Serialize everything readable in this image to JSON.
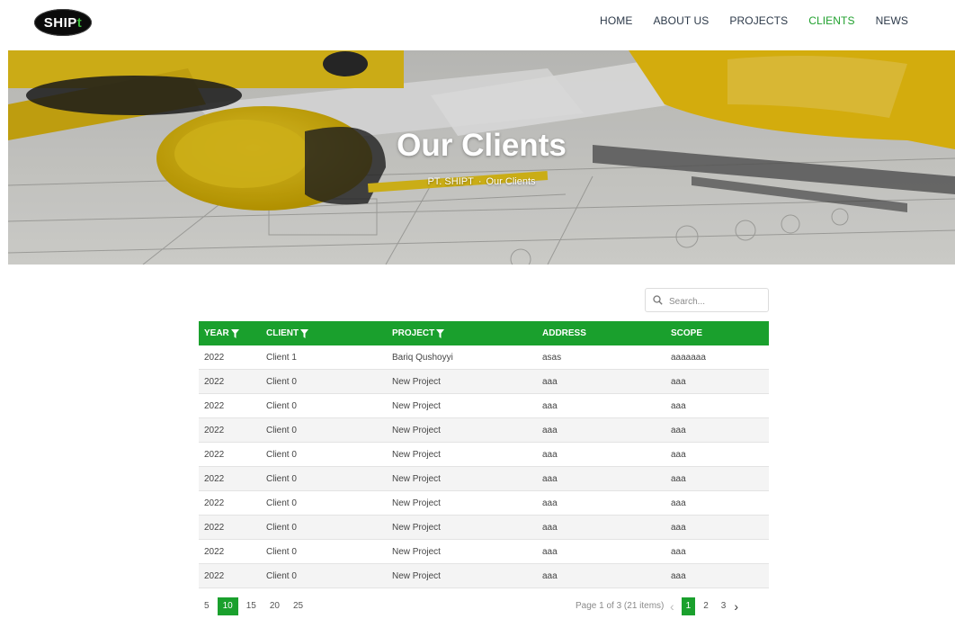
{
  "logo": {
    "text_main": "SHIP",
    "text_accent": "t"
  },
  "nav": {
    "items": [
      {
        "label": "HOME"
      },
      {
        "label": "ABOUT US"
      },
      {
        "label": "PROJECTS"
      },
      {
        "label": "CLIENTS"
      },
      {
        "label": "NEWS"
      }
    ],
    "active_index": 3
  },
  "hero": {
    "title": "Our Clients",
    "breadcrumb": {
      "home": "PT. SHIPT",
      "separator": "·",
      "current": "Our Clients"
    }
  },
  "search": {
    "placeholder": "Search..."
  },
  "table": {
    "columns": [
      {
        "label": "YEAR",
        "filter": true
      },
      {
        "label": "CLIENT",
        "filter": true
      },
      {
        "label": "PROJECT",
        "filter": true
      },
      {
        "label": "ADDRESS",
        "filter": false
      },
      {
        "label": "SCOPE",
        "filter": false
      }
    ],
    "rows": [
      [
        "2022",
        "Client 1",
        "Bariq Qushoyyi",
        "asas",
        "aaaaaaa"
      ],
      [
        "2022",
        "Client 0",
        "New Project",
        "aaa",
        "aaa"
      ],
      [
        "2022",
        "Client 0",
        "New Project",
        "aaa",
        "aaa"
      ],
      [
        "2022",
        "Client 0",
        "New Project",
        "aaa",
        "aaa"
      ],
      [
        "2022",
        "Client 0",
        "New Project",
        "aaa",
        "aaa"
      ],
      [
        "2022",
        "Client 0",
        "New Project",
        "aaa",
        "aaa"
      ],
      [
        "2022",
        "Client 0",
        "New Project",
        "aaa",
        "aaa"
      ],
      [
        "2022",
        "Client 0",
        "New Project",
        "aaa",
        "aaa"
      ],
      [
        "2022",
        "Client 0",
        "New Project",
        "aaa",
        "aaa"
      ],
      [
        "2022",
        "Client 0",
        "New Project",
        "aaa",
        "aaa"
      ]
    ]
  },
  "pager": {
    "page_sizes": [
      "5",
      "10",
      "15",
      "20",
      "25"
    ],
    "selected_size": "10",
    "info": "Page 1 of 3 (21 items)",
    "pages": [
      "1",
      "2",
      "3"
    ],
    "current_page": "1",
    "prev_icon": "chevron-left-icon",
    "next_icon": "chevron-right-icon"
  },
  "colors": {
    "accent": "#1aa02d",
    "nav_active": "#21a12f",
    "nav_text": "#2d3a4a"
  }
}
